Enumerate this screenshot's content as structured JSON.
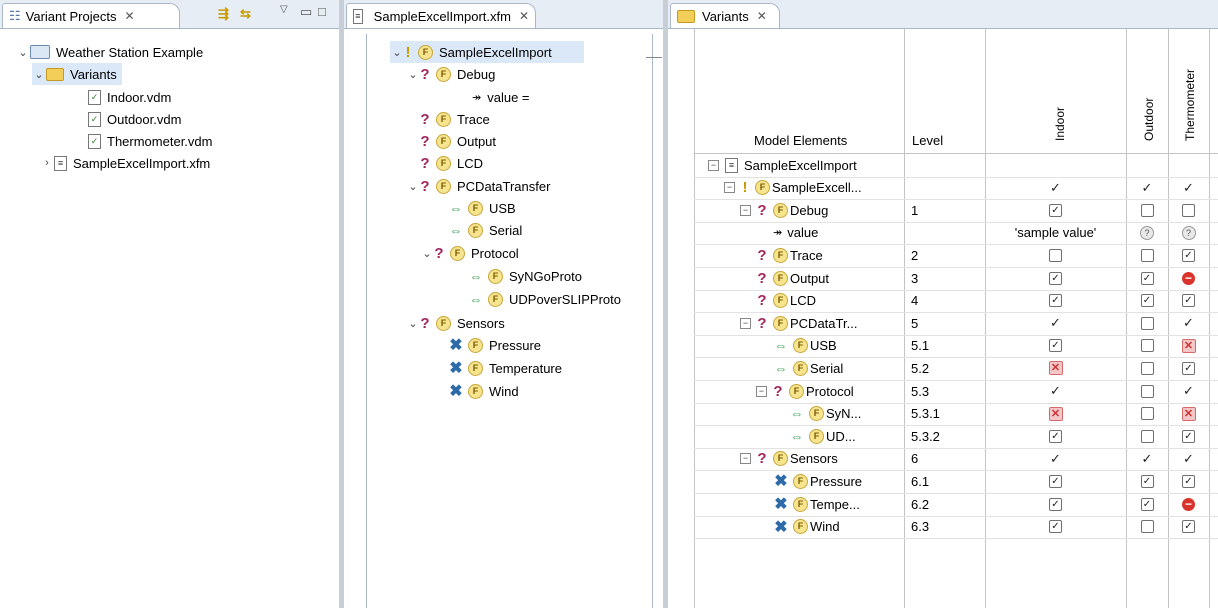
{
  "colors": {
    "accent": "#dbe8f8",
    "tabbar": "#e7edf4",
    "stop": "#d8342c"
  },
  "left": {
    "tab_title": "Variant Projects",
    "tree": {
      "project": "Weather Station Example",
      "folder": "Variants",
      "files": [
        "Indoor.vdm",
        "Outdoor.vdm",
        "Thermometer.vdm"
      ],
      "model": "SampleExcelImport.xfm"
    }
  },
  "middle": {
    "tab_title": "SampleExcelImport.xfm",
    "root": "SampleExcelImport",
    "debug": "Debug",
    "debug_value": "value =",
    "trace": "Trace",
    "output": "Output",
    "lcd": "LCD",
    "pcdata": "PCDataTransfer",
    "usb": "USB",
    "serial": "Serial",
    "protocol": "Protocol",
    "syngo": "SyNGoProto",
    "udpover": "UDPoverSLIPProto",
    "sensors": "Sensors",
    "pressure": "Pressure",
    "temperature": "Temperature",
    "wind": "Wind"
  },
  "right": {
    "tab_title": "Variants",
    "columns": {
      "model_elements": "Model Elements",
      "level": "Level",
      "indoor": "Indoor",
      "outdoor": "Outdoor",
      "thermometer": "Thermometer"
    },
    "rows": [
      {
        "name": "SampleExcelImport",
        "icon": "model",
        "indent": 0,
        "level": "",
        "indoor": "",
        "outdoor": "",
        "thermo": "",
        "expander": true
      },
      {
        "name": "SampleExcell...",
        "icon": "mandatory",
        "indent": 1,
        "level": "",
        "indoor": "tick",
        "outdoor": "tick",
        "thermo": "tick",
        "expander": true
      },
      {
        "name": "Debug",
        "icon": "optional",
        "indent": 2,
        "level": "1",
        "indoor": "checked",
        "outdoor": "empty",
        "thermo": "empty",
        "expander": true
      },
      {
        "name": "value",
        "icon": "attribute",
        "indent": 3,
        "level": "",
        "indoor": "text",
        "indoor_text": "'sample value'",
        "outdoor": "question",
        "thermo": "question",
        "expander": false
      },
      {
        "name": "Trace",
        "icon": "optional",
        "indent": 2,
        "level": "2",
        "indoor": "empty",
        "outdoor": "empty",
        "thermo": "checked",
        "expander": false
      },
      {
        "name": "Output",
        "icon": "optional",
        "indent": 2,
        "level": "3",
        "indoor": "checked",
        "outdoor": "checked",
        "thermo": "stop",
        "expander": false
      },
      {
        "name": "LCD",
        "icon": "optional",
        "indent": 2,
        "level": "4",
        "indoor": "checked",
        "outdoor": "checked",
        "thermo": "checked",
        "expander": false
      },
      {
        "name": "PCDataTr...",
        "icon": "optional",
        "indent": 2,
        "level": "5",
        "indoor": "tick",
        "outdoor": "empty",
        "thermo": "tick",
        "expander": true
      },
      {
        "name": "USB",
        "icon": "alternative",
        "indent": 3,
        "level": "5.1",
        "indoor": "checked",
        "outdoor": "empty",
        "thermo": "excluded",
        "expander": false
      },
      {
        "name": "Serial",
        "icon": "alternative",
        "indent": 3,
        "level": "5.2",
        "indoor": "excluded",
        "outdoor": "empty",
        "thermo": "checked",
        "expander": false
      },
      {
        "name": "Protocol",
        "icon": "optional",
        "indent": 3,
        "level": "5.3",
        "indoor": "tick",
        "outdoor": "empty",
        "thermo": "tick",
        "expander": true
      },
      {
        "name": "SyN...",
        "icon": "alternative",
        "indent": 4,
        "level": "5.3.1",
        "indoor": "excluded",
        "outdoor": "empty",
        "thermo": "excluded",
        "expander": false
      },
      {
        "name": "UD...",
        "icon": "alternative",
        "indent": 4,
        "level": "5.3.2",
        "indoor": "checked",
        "outdoor": "empty",
        "thermo": "checked",
        "expander": false
      },
      {
        "name": "Sensors",
        "icon": "optional",
        "indent": 2,
        "level": "6",
        "indoor": "tick",
        "outdoor": "tick",
        "thermo": "tick",
        "expander": true
      },
      {
        "name": "Pressure",
        "icon": "or",
        "indent": 3,
        "level": "6.1",
        "indoor": "checked",
        "outdoor": "checked",
        "thermo": "checked",
        "expander": false
      },
      {
        "name": "Tempe...",
        "icon": "or",
        "indent": 3,
        "level": "6.2",
        "indoor": "checked",
        "outdoor": "checked",
        "thermo": "stop",
        "expander": false
      },
      {
        "name": "Wind",
        "icon": "or",
        "indent": 3,
        "level": "6.3",
        "indoor": "checked",
        "outdoor": "empty",
        "thermo": "checked",
        "expander": false
      }
    ]
  }
}
